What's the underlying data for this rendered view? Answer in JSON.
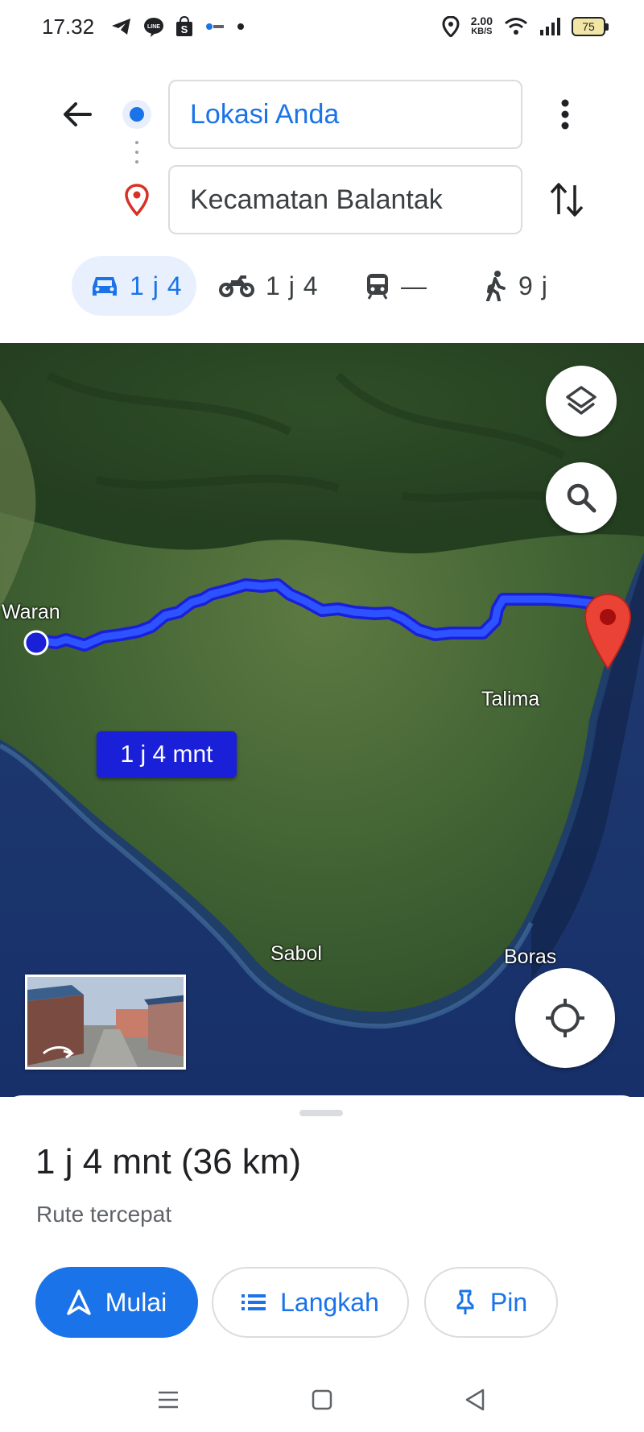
{
  "status_bar": {
    "time": "17.32",
    "speed_value": "2.00",
    "speed_unit": "KB/S",
    "battery": "75",
    "icons_left": [
      "telegram-icon",
      "line-icon",
      "shop-icon",
      "app-icon",
      "dot-icon"
    ],
    "icons_right": [
      "location-icon",
      "wifi-icon",
      "signal-icon",
      "battery-icon"
    ]
  },
  "directions": {
    "origin": "Lokasi Anda",
    "destination": "Kecamatan Balantak",
    "colors": {
      "accent": "#1a73e8",
      "pin": "#d93025"
    }
  },
  "modes": [
    {
      "name": "car",
      "label": "1 j 4",
      "selected": true
    },
    {
      "name": "motorcycle",
      "label": "1 j 4",
      "selected": false
    },
    {
      "name": "transit",
      "label": "—",
      "selected": false
    },
    {
      "name": "walk",
      "label": "9 j",
      "selected": false
    }
  ],
  "map": {
    "labels": {
      "waran": "Waran",
      "talima": "Talima",
      "sabol": "Sabol",
      "boras": "Boras"
    },
    "eta_bubble": "1 j 4 mnt",
    "route_color": "#1a36f0"
  },
  "sheet": {
    "summary": "1 j 4 mnt (36 km)",
    "subtitle": "Rute tercepat",
    "buttons": {
      "start": "Mulai",
      "steps": "Langkah",
      "pin": "Pin"
    }
  },
  "navbar": {
    "icons": [
      "menu-icon",
      "home-icon",
      "back-nav-icon"
    ]
  }
}
